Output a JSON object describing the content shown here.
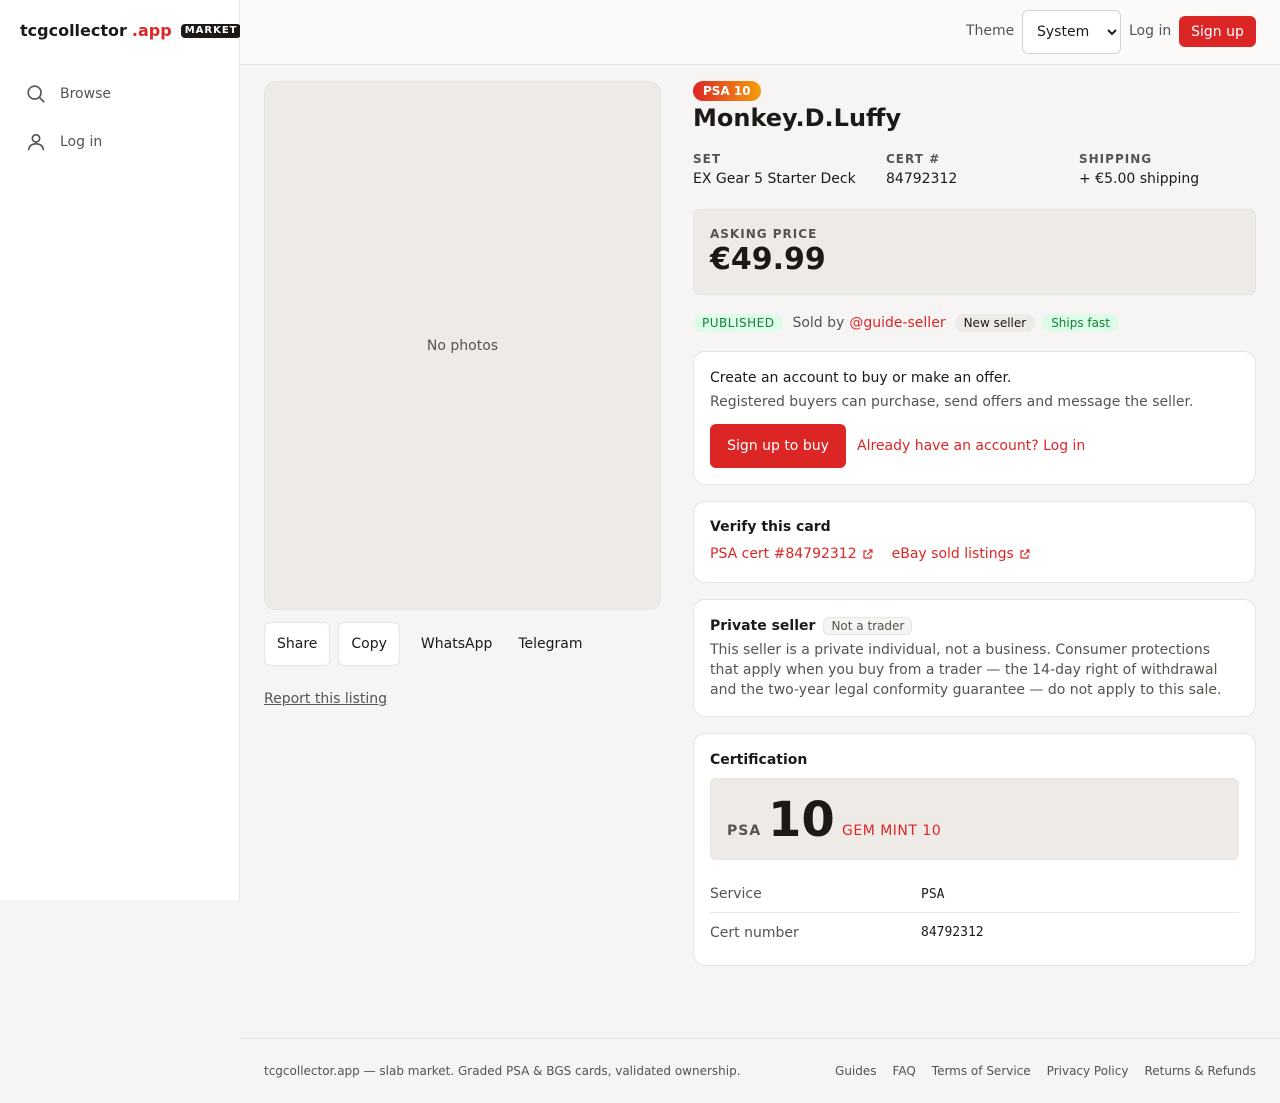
{
  "brand": {
    "name": "tcgcollector",
    "suffix": ".app",
    "badge": "MARKET"
  },
  "sidebar": {
    "items": [
      {
        "label": "Browse",
        "icon": "search-icon"
      },
      {
        "label": "Log in",
        "icon": "user-icon"
      }
    ]
  },
  "topbar": {
    "theme_label": "Theme",
    "theme_selected": "System",
    "login_label": "Log in",
    "signup_label": "Sign up"
  },
  "gallery": {
    "empty_text": "No photos",
    "share_buttons": [
      "Share",
      "Copy",
      "WhatsApp",
      "Telegram"
    ],
    "report_label": "Report this listing"
  },
  "listing": {
    "grade_badge": "PSA 10",
    "title": "Monkey.D.Luffy",
    "set_label": "SET",
    "set_value": "EX Gear 5 Starter Deck",
    "cert_label": "CERT #",
    "cert_value": "84792312",
    "shipping_label": "SHIPPING",
    "shipping_value": "+ €5.00 shipping",
    "price_label": "ASKING PRICE",
    "price_value": "€49.99",
    "status": "PUBLISHED",
    "sold_by": "Sold by",
    "seller": "@guide-seller",
    "seller_badges": [
      "New seller",
      "Ships fast"
    ]
  },
  "account_panel": {
    "title": "Create an account to buy or make an offer.",
    "subtitle": "Registered buyers can purchase, send offers and message the seller.",
    "signup_button": "Sign up to buy",
    "login_link": "Already have an account? Log in"
  },
  "verify_panel": {
    "title": "Verify this card",
    "links": [
      "PSA cert #84792312",
      "eBay sold listings"
    ]
  },
  "private_panel": {
    "title": "Private seller",
    "badge": "Not a trader",
    "body": "This seller is a private individual, not a business. Consumer protections that apply when you buy from a trader — the 14-day right of withdrawal and the two-year legal conformity guarantee — do not apply to this sale."
  },
  "cert_panel": {
    "title": "Certification",
    "service": "PSA",
    "grade": "10",
    "grade_desc": "GEM MINT 10",
    "rows": [
      {
        "key": "Service",
        "value": "PSA"
      },
      {
        "key": "Cert number",
        "value": "84792312"
      }
    ]
  },
  "footer": {
    "text": "tcgcollector.app — slab market. Graded PSA & BGS cards, validated ownership.",
    "links": [
      "Guides",
      "FAQ",
      "Terms of Service",
      "Privacy Policy",
      "Returns & Refunds"
    ]
  },
  "colors": {
    "accent": "#dc2626",
    "success": "#15803d",
    "muted": "#57534e"
  }
}
